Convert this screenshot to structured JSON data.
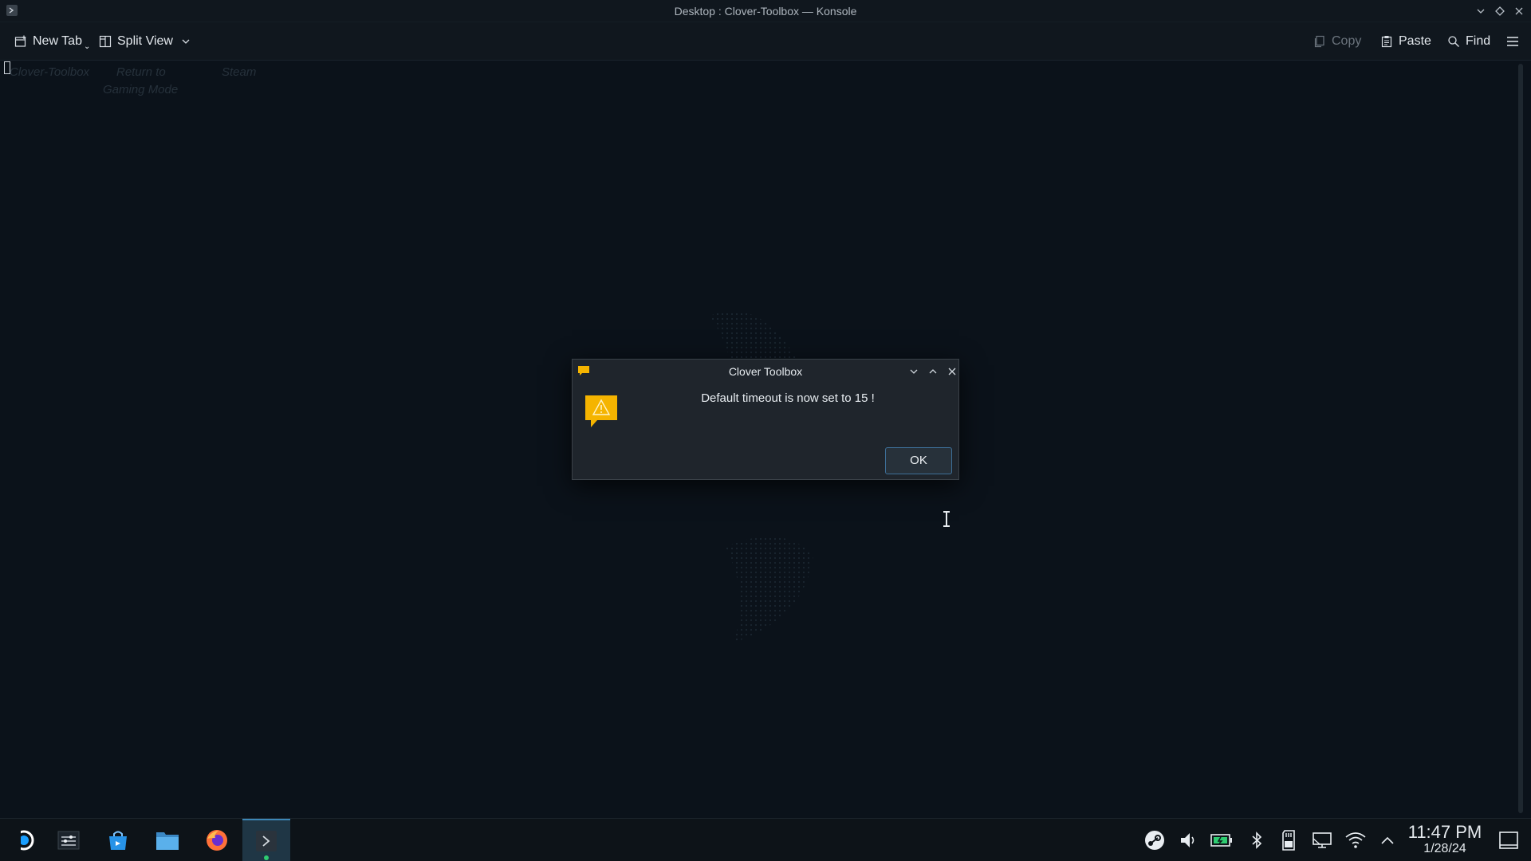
{
  "window": {
    "title": "Desktop : Clover-Toolbox — Konsole"
  },
  "toolbar": {
    "new_tab_label": "New Tab",
    "split_view_label": "Split View",
    "copy_label": "Copy",
    "paste_label": "Paste",
    "find_label": "Find"
  },
  "terminal": {
    "items": [
      "Clover-Toolbox",
      "Return to",
      "Gaming Mode",
      "Steam"
    ]
  },
  "dialog": {
    "title": "Clover Toolbox",
    "message": "Default timeout is now set to 15 !",
    "ok_label": "OK"
  },
  "taskbar": {
    "apps": [
      "steam-deck-icon",
      "system-settings-icon",
      "discover-store-icon",
      "file-manager-icon",
      "firefox-icon",
      "konsole-icon"
    ],
    "tray": [
      "steam-tray-icon",
      "volume-icon",
      "battery-icon",
      "bluetooth-icon",
      "sd-card-icon",
      "display-icon",
      "wifi-icon",
      "expand-tray-icon"
    ],
    "clock": {
      "time": "11:47 PM",
      "date": "1/28/24"
    }
  },
  "colors": {
    "background": "#0b121a",
    "dialog": "#1f252c",
    "accent": "#3d86b6",
    "warning": "#f5b400"
  }
}
